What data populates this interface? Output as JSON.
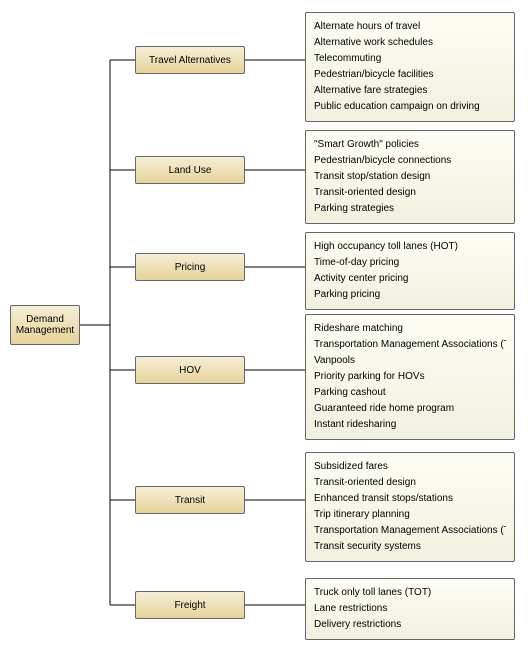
{
  "root": {
    "label": "Demand Management"
  },
  "categories": [
    {
      "label": "Travel Alternatives",
      "items": [
        "Alternate hours of travel",
        "Alternative work schedules",
        "Telecommuting",
        "Pedestrian/bicycle facilities",
        "Alternative fare strategies",
        "Public education campaign on driving"
      ]
    },
    {
      "label": "Land Use",
      "items": [
        "\"Smart Growth\" policies",
        "Pedestrian/bicycle connections",
        "Transit stop/station design",
        "Transit-oriented design",
        "Parking strategies"
      ]
    },
    {
      "label": "Pricing",
      "items": [
        "High occupancy toll lanes (HOT)",
        "Time-of-day pricing",
        "Activity center pricing",
        "Parking pricing"
      ]
    },
    {
      "label": "HOV",
      "items": [
        "Rideshare matching",
        "Transportation Management Associations (TMAs)",
        "Vanpools",
        "Priority parking for HOVs",
        "Parking cashout",
        "Guaranteed ride home program",
        "Instant ridesharing"
      ]
    },
    {
      "label": "Transit",
      "items": [
        "Subsidized fares",
        "Transit-oriented design",
        "Enhanced transit stops/stations",
        "Trip itinerary planning",
        "Transportation Management Associations (TMAs)",
        "Transit security systems"
      ]
    },
    {
      "label": "Freight",
      "items": [
        "Truck only toll lanes (TOT)",
        "Lane restrictions",
        "Delivery restrictions"
      ]
    }
  ]
}
